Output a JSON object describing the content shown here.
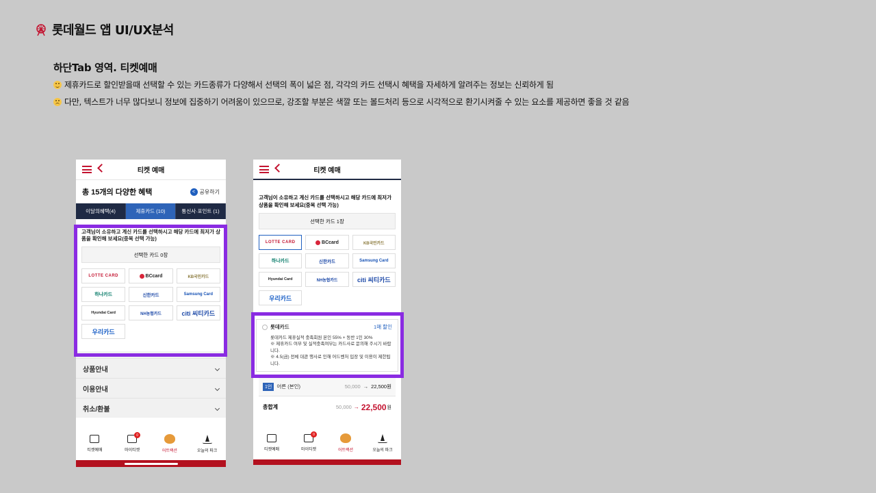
{
  "page": {
    "title": "롯데월드 앱 UI/UX분석",
    "logo_icon": "ferris-wheel-icon",
    "section_title": "하단Tab 영역. 티켓예매",
    "notes": [
      {
        "icon": "smile-emoji-icon",
        "text": "제휴카드로 할인받을때 선택할 수 있는 카드종류가 다양해서 선택의 폭이 넓은 점, 각각의 카드 선택시 혜택을 자세하게 알려주는 정보는 신뢰하게 됨"
      },
      {
        "icon": "sad-emoji-icon",
        "text": "다만, 텍스트가 너무 많다보니 정보에 집중하기 어려움이 있으므로, 강조할 부분은 색깔 또는 볼드처리 등으로 시각적으로 환기시켜줄 수 있는 요소를 제공하면 좋을 것 같음"
      }
    ],
    "highlight_color": "#8a2be2"
  },
  "phone1": {
    "header_title": "티켓 예매",
    "benefit_title": "총 15개의 다양한 혜택",
    "share_label": "공유하기",
    "tabs": [
      {
        "label": "이달의혜택(4)",
        "active": false
      },
      {
        "label": "제휴카드 (10)",
        "active": true
      },
      {
        "label": "통신사·포인트 (1)",
        "active": false
      }
    ],
    "card_desc": "고객님이 소유하고 계신 카드를 선택하시고 해당 카드에 최저가 상품을 확인해 보세요(중복 선택 가능)",
    "selected_label": "선택한 카드",
    "selected_count": "0장",
    "cards": [
      "LOTTE CARD",
      "BCcard",
      "KB국민카드",
      "하나카드",
      "신한카드",
      "Samsung Card",
      "Hyundai Card",
      "NH농협카드",
      "citi 씨티카드",
      "우리카드"
    ],
    "accordion": [
      "상품안내",
      "이용안내",
      "취소/환불"
    ]
  },
  "phone2": {
    "header_title": "티켓 예매",
    "card_desc": "고객님이 소유하고 계신 카드를 선택하시고 해당 카드에 최저가 상품을 확인해 보세요(중복 선택 가능)",
    "selected_label": "선택한 카드",
    "selected_count": "1장",
    "cards": [
      "LOTTE CARD",
      "BCcard",
      "KB국민카드",
      "하나카드",
      "신한카드",
      "Samsung Card",
      "Hyundai Card",
      "NH농협카드",
      "citi 씨티카드",
      "우리카드"
    ],
    "benefit": {
      "name": "롯데카드",
      "discount": "1매 할인",
      "line1": "롯데카드 제휴실적 충족회원 본인 55% + 동반 1인 30%",
      "line2": "※ 제휴카드 여부 및 실적충족여부는 카드사로 문의해 주시기 바랍니다.",
      "line3": "※ 4.5(금) 전체 대관 행사로 인해 어드벤처 입장 및 이용이 제한됩니다."
    },
    "price_row": {
      "badge": "1인",
      "label": "어른 (본인)",
      "old": "50,000",
      "arrow": "→",
      "new": "22,500원"
    },
    "total": {
      "label": "총합계",
      "old": "50,000",
      "arrow": "→",
      "new": "22,500",
      "unit": "원"
    }
  },
  "bottom_nav": [
    {
      "label": "티켓예매",
      "icon": "ticket-icon",
      "active": false
    },
    {
      "label": "마이티켓",
      "icon": "my-ticket-icon",
      "active": false,
      "badge": "0"
    },
    {
      "label": "어트랙션",
      "icon": "tiger-icon",
      "active": true
    },
    {
      "label": "오늘의 파크",
      "icon": "park-icon",
      "active": false
    }
  ]
}
